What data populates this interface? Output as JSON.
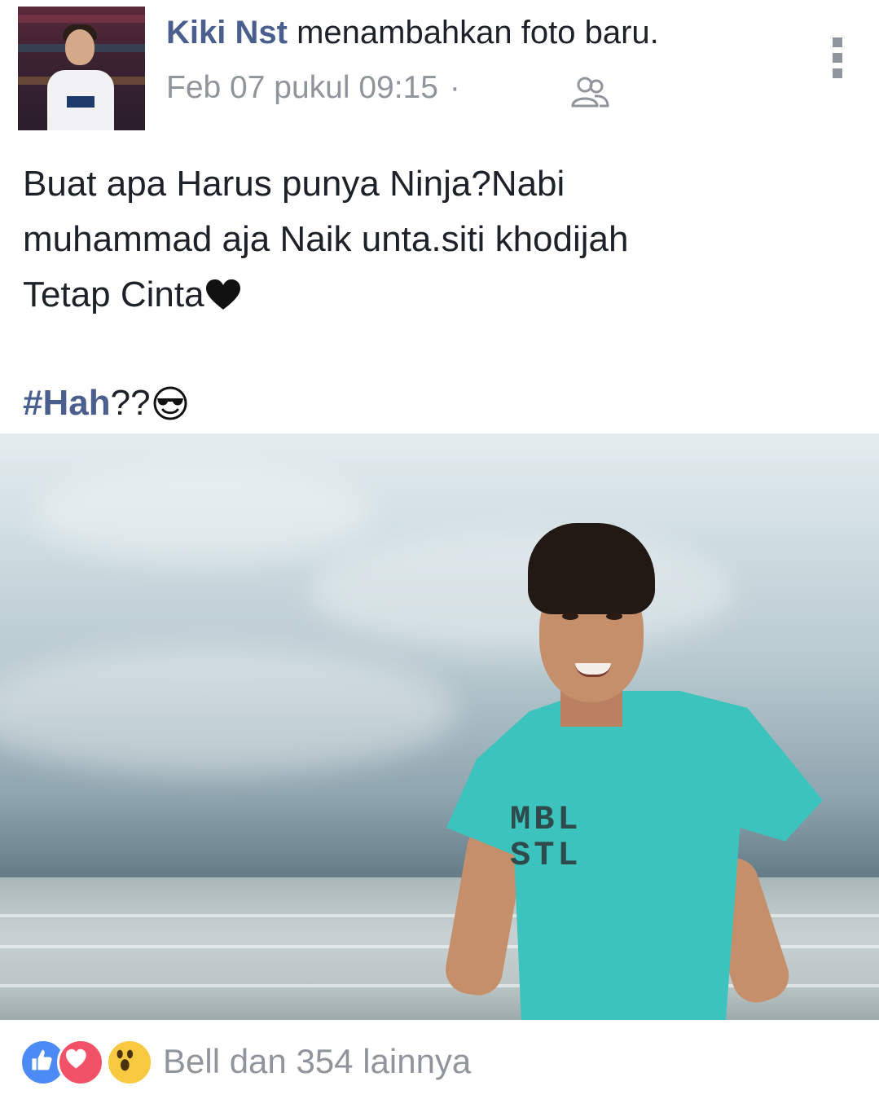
{
  "post": {
    "author": "Kiki Nst",
    "action": "menambahkan foto baru.",
    "date": "Feb 07 pukul 09:15",
    "meta_separator": "·",
    "audience_icon": "friends-icon",
    "more_icon": "more-vertical-icon",
    "text_lines": [
      "Buat apa Harus punya Ninja?Nabi",
      "muhammad aja Naik unta.siti khodijah",
      "Tetap Cinta"
    ],
    "heart_emoji": "black-heart-icon",
    "hashtag": "#Hah",
    "hashtag_suffix": "??",
    "hashtag_emoji": "sunglasses-emoji-icon",
    "photo_shirt_text": [
      "MBL",
      "STL"
    ],
    "photo_shirt_lines": [
      " MBL",
      " STL"
    ]
  },
  "reactions": {
    "icons": [
      "like-icon",
      "love-icon",
      "wow-icon"
    ],
    "summary": "Bell dan 354 lainnya"
  },
  "colors": {
    "author": "#4b5f8e",
    "meta": "#90949c",
    "like": "#4c8bf5",
    "love": "#f25268",
    "wow": "#f7c940",
    "shirt": "#3cc3bd"
  }
}
